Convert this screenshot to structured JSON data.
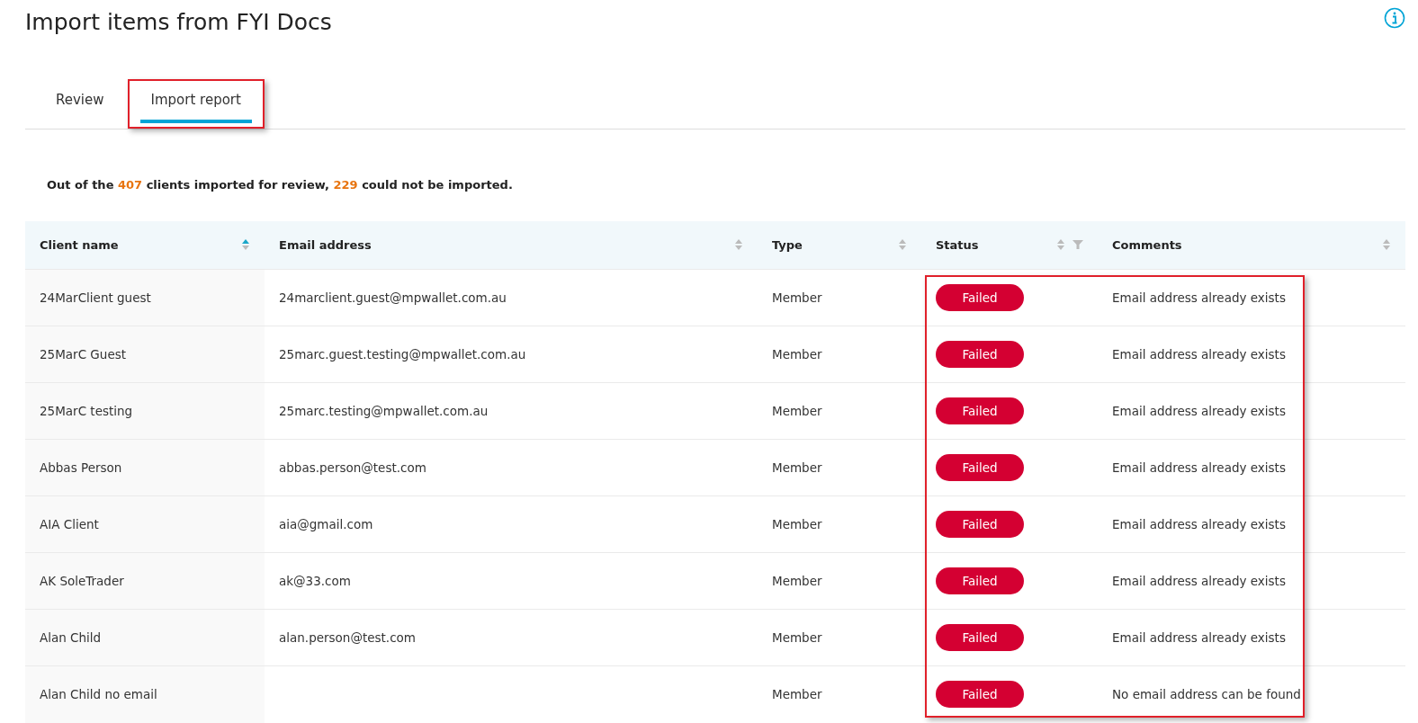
{
  "page": {
    "title": "Import items from FYI Docs"
  },
  "tabs": [
    {
      "label": "Review",
      "selected": false,
      "highlighted": false
    },
    {
      "label": "Import report",
      "selected": true,
      "highlighted": true
    }
  ],
  "summary": [
    {
      "kind": "text",
      "text": "Out of the"
    },
    {
      "kind": "number",
      "text": "407"
    },
    {
      "kind": "text",
      "text": "clients imported for review,"
    },
    {
      "kind": "number",
      "text": "229"
    },
    {
      "kind": "text",
      "text": "could not be imported."
    }
  ],
  "table": {
    "highlight_status_comments": true,
    "columns": [
      {
        "label": "Client name",
        "sorted": true
      },
      {
        "label": "Email address",
        "sorted": false
      },
      {
        "label": "Type",
        "sorted": false
      },
      {
        "label": "Status",
        "sorted": false,
        "filter": true
      },
      {
        "label": "Comments",
        "sorted": false
      }
    ],
    "rows": [
      {
        "name": "24MarClient guest",
        "email": "24marclient.guest@mpwallet.com.au",
        "type": "Member",
        "status": "Failed",
        "comment": "Email address already exists"
      },
      {
        "name": "25MarC Guest",
        "email": "25marc.guest.testing@mpwallet.com.au",
        "type": "Member",
        "status": "Failed",
        "comment": "Email address already exists"
      },
      {
        "name": "25MarC testing",
        "email": "25marc.testing@mpwallet.com.au",
        "type": "Member",
        "status": "Failed",
        "comment": "Email address already exists"
      },
      {
        "name": "Abbas Person",
        "email": "abbas.person@test.com",
        "type": "Member",
        "status": "Failed",
        "comment": "Email address already exists"
      },
      {
        "name": "AIA Client",
        "email": "aia@gmail.com",
        "type": "Member",
        "status": "Failed",
        "comment": "Email address already exists"
      },
      {
        "name": "AK SoleTrader",
        "email": "ak@33.com",
        "type": "Member",
        "status": "Failed",
        "comment": "Email address already exists"
      },
      {
        "name": "Alan Child",
        "email": "alan.person@test.com",
        "type": "Member",
        "status": "Failed",
        "comment": "Email address already exists"
      },
      {
        "name": "Alan Child no email",
        "type": "Member",
        "status": "Failed",
        "comment": "No email address can be found"
      }
    ]
  }
}
